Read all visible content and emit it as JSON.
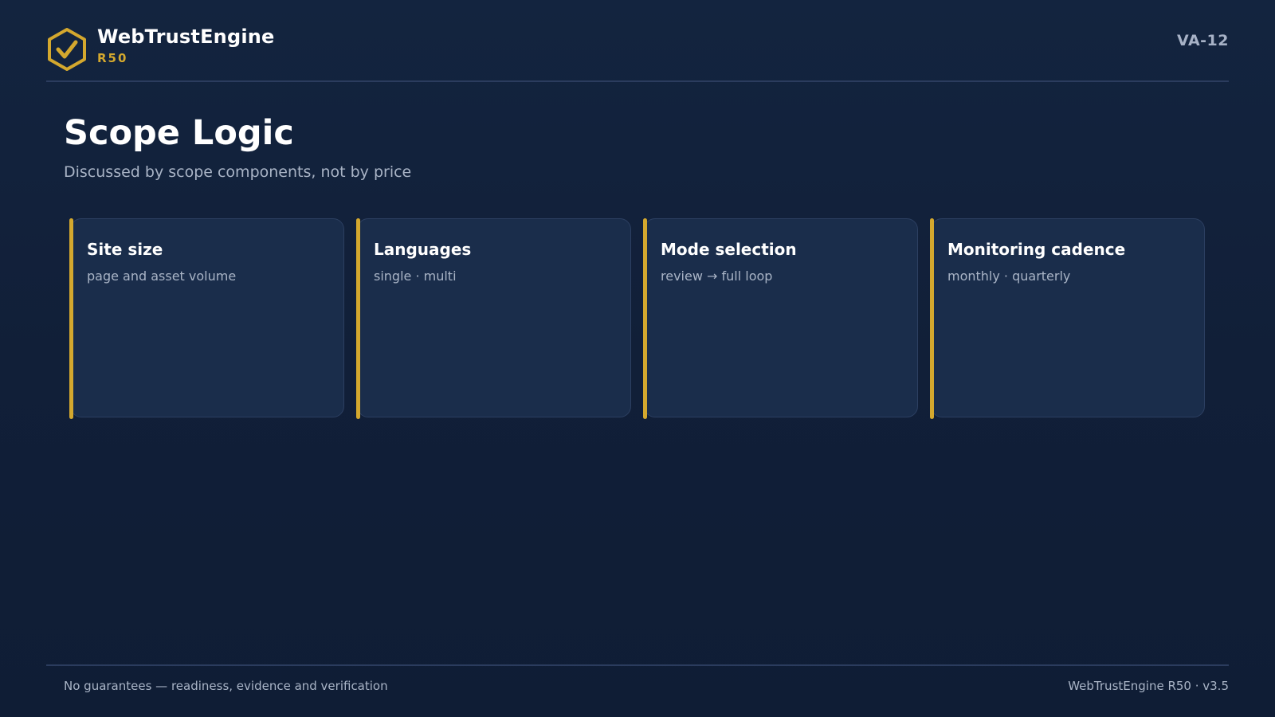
{
  "header": {
    "brand_name": "WebTrustEngine",
    "brand_sub": "R50",
    "logo_icon": "hexagon-check-icon",
    "code": "VA-12"
  },
  "main": {
    "title": "Scope Logic",
    "subtitle": "Discussed by scope components, not by price",
    "cards": [
      {
        "title": "Site size",
        "desc": "page and asset volume"
      },
      {
        "title": "Languages",
        "desc": "single · multi"
      },
      {
        "title": "Mode selection",
        "desc": "review → full loop"
      },
      {
        "title": "Monitoring cadence",
        "desc": "monthly · quarterly"
      }
    ]
  },
  "footer": {
    "left": "No guarantees — readiness, evidence and verification",
    "right": "WebTrustEngine R50 · v3.5"
  },
  "colors": {
    "background": "#122240",
    "accent": "#d4a82e",
    "card": "#1a2d4b",
    "muted_text": "#a9b4c6"
  }
}
